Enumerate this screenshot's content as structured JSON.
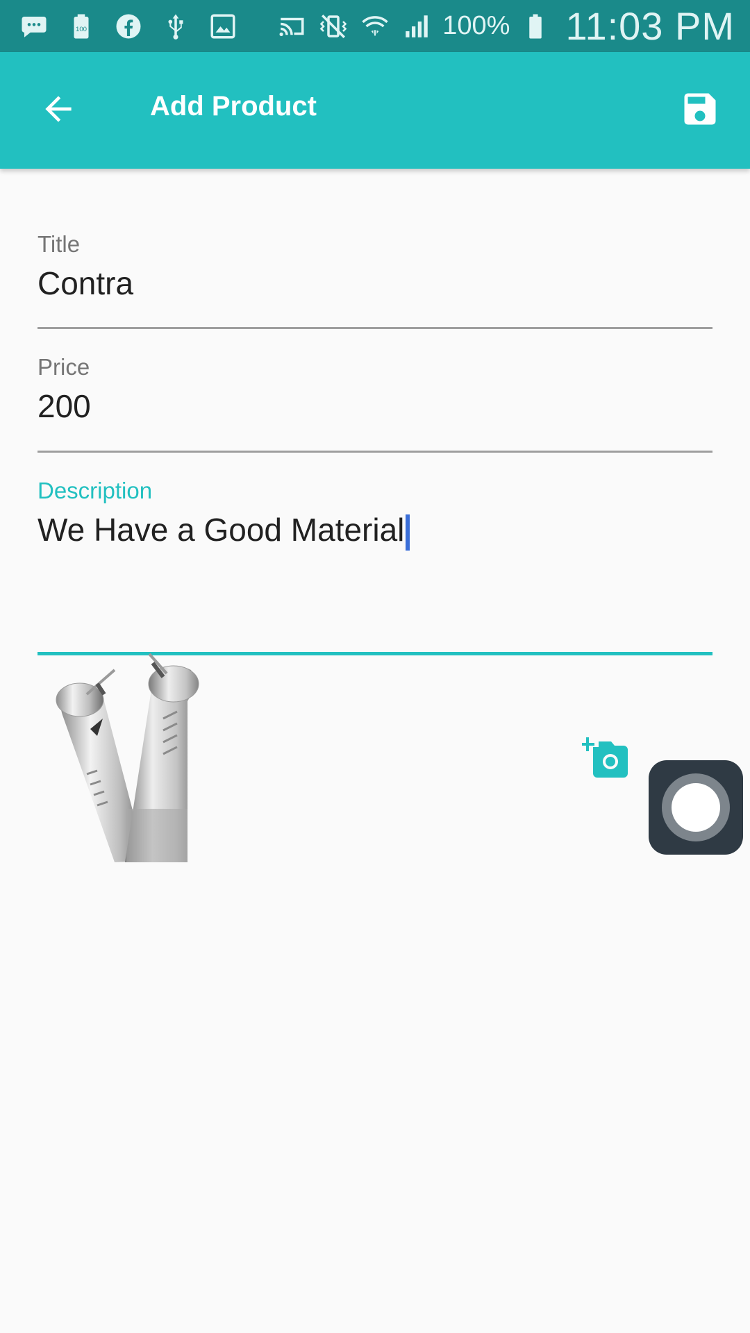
{
  "status_bar": {
    "battery_percent": "100%",
    "time": "11:03 PM",
    "icons": [
      "message-icon",
      "battery-saver-icon",
      "facebook-icon",
      "usb-icon",
      "image-icon",
      "cast-icon",
      "vibrate-off-icon",
      "wifi-icon",
      "signal-icon",
      "battery-icon"
    ]
  },
  "app_bar": {
    "title": "Add Product",
    "back_icon": "arrow-back-icon",
    "save_icon": "save-icon",
    "background": "#22c0c0"
  },
  "form": {
    "title_label": "Title",
    "title_value": "Contra",
    "price_label": "Price",
    "price_value": "200",
    "description_label": "Description",
    "description_value": "We Have a Good Material",
    "focused_field": "description"
  },
  "image_section": {
    "image_icon": "dental-handpiece-image",
    "add_photo_icon": "add-a-photo-icon"
  },
  "overlay": {
    "assistive_touch_icon": "assistive-touch-icon"
  },
  "colors": {
    "accent": "#22c0c0",
    "status_bar": "#1a8a8a",
    "text": "#212121",
    "label": "#757575"
  }
}
